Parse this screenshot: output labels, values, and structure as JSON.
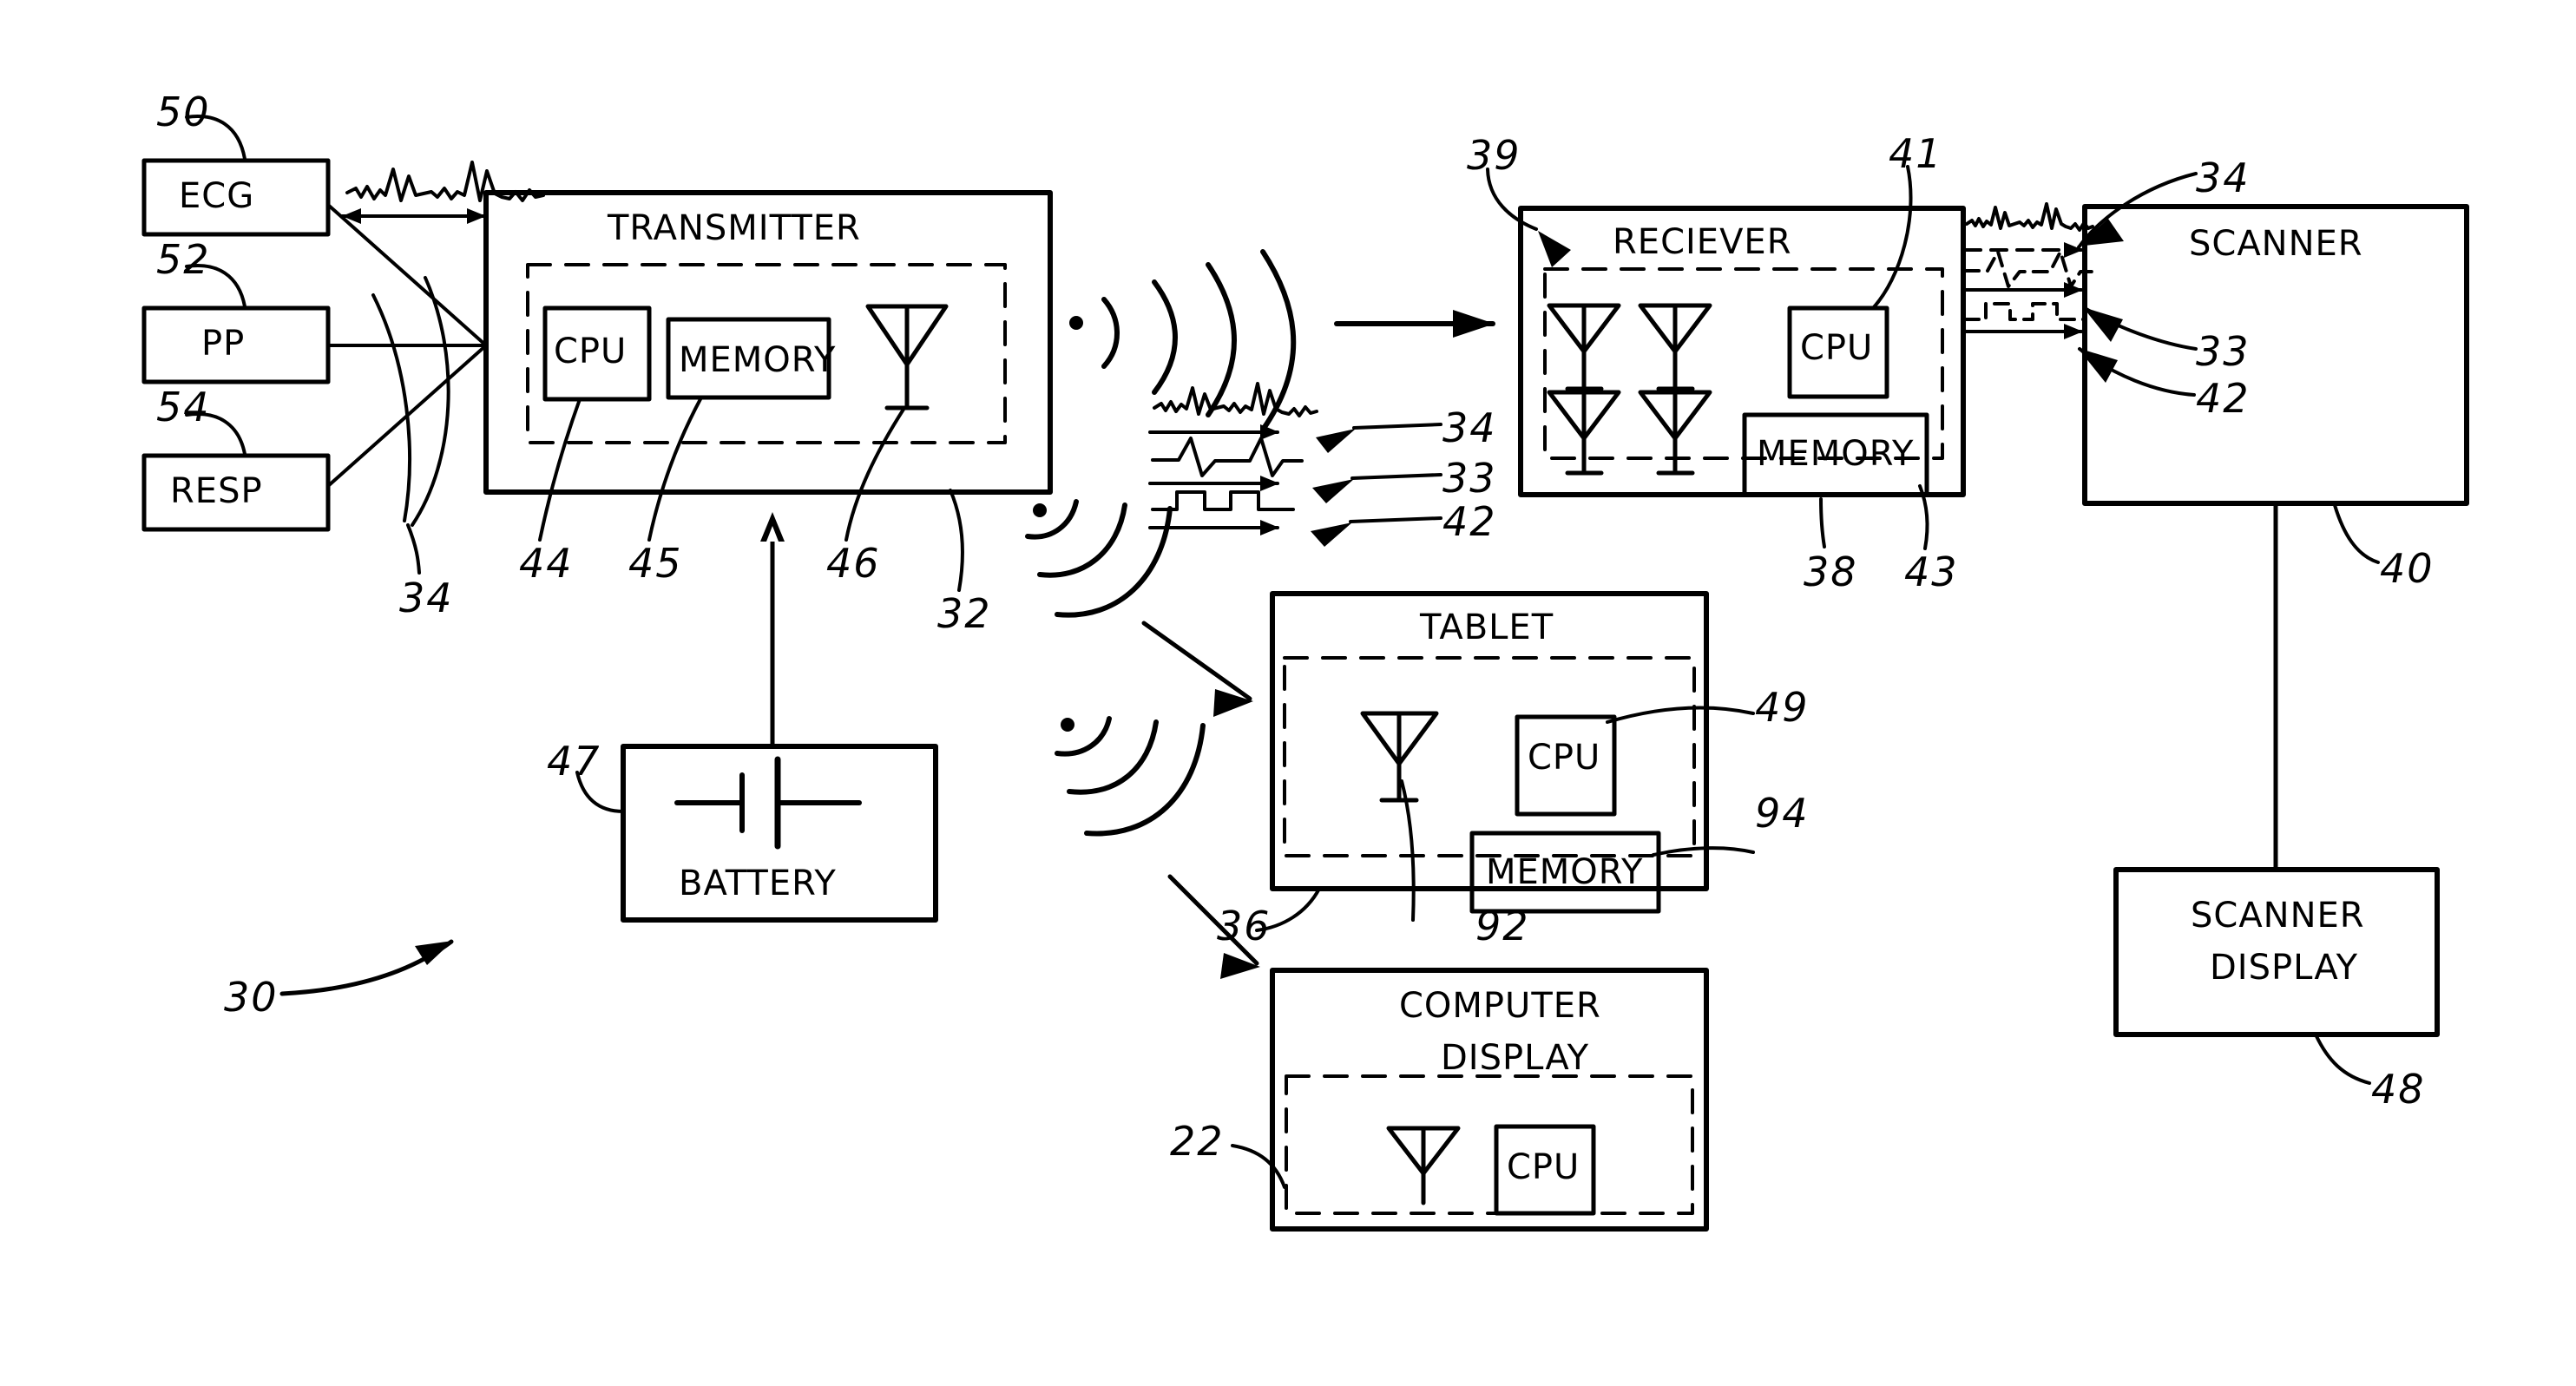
{
  "figure": {
    "kind": "patent-block-diagram",
    "system_ref": "30"
  },
  "blocks": [
    {
      "id": "ecg",
      "label": "ECG",
      "ref": "50"
    },
    {
      "id": "pp",
      "label": "PP",
      "ref": "52"
    },
    {
      "id": "resp",
      "label": "RESP",
      "ref": "54"
    },
    {
      "id": "transmitter",
      "label": "TRANSMITTER",
      "ref": "32",
      "children": [
        {
          "label": "CPU",
          "ref": "44"
        },
        {
          "label": "MEMORY",
          "ref": "45"
        },
        {
          "label": "antenna",
          "ref": "46"
        }
      ]
    },
    {
      "id": "battery",
      "label": "BATTERY",
      "ref": "47"
    },
    {
      "id": "receiver",
      "label": "RECIEVER",
      "ref": "38",
      "children": [
        {
          "label": "CPU",
          "ref": "41"
        },
        {
          "label": "MEMORY",
          "ref": "43"
        },
        {
          "label": "antenna-array",
          "ref": "39"
        }
      ]
    },
    {
      "id": "scanner",
      "label": "SCANNER",
      "ref": "40"
    },
    {
      "id": "scanner_display",
      "label_line1": "SCANNER",
      "label_line2": "DISPLAY",
      "ref": "48"
    },
    {
      "id": "tablet",
      "label": "TABLET",
      "ref": "36",
      "children": [
        {
          "label": "CPU",
          "ref": "49"
        },
        {
          "label": "MEMORY",
          "ref": "94"
        },
        {
          "label": "antenna",
          "ref": "92"
        }
      ]
    },
    {
      "id": "computer_display",
      "label_line1": "COMPUTER",
      "label_line2": "DISPLAY",
      "ref": "22",
      "children": [
        {
          "label": "CPU",
          "ref": ""
        },
        {
          "label": "antenna",
          "ref": ""
        }
      ]
    }
  ],
  "signals": {
    "ecg_waveform_ref": "34",
    "sensor_bundle_ref": "34",
    "mid_waveforms": [
      {
        "ref": "34",
        "type": "ecg"
      },
      {
        "ref": "33",
        "type": "pulse"
      },
      {
        "ref": "42",
        "type": "square"
      }
    ],
    "scanner_inputs": [
      {
        "ref": "34",
        "type": "ecg"
      },
      {
        "ref": "33",
        "type": "pulse"
      },
      {
        "ref": "42",
        "type": "square"
      }
    ]
  },
  "refs": {
    "r22": "22",
    "r30": "30",
    "r32": "32",
    "r33": "33",
    "r34": "34",
    "r34b": "34",
    "r34c": "34",
    "r36": "36",
    "r38": "38",
    "r39": "39",
    "r40": "40",
    "r41": "41",
    "r42": "42",
    "r42b": "42",
    "r43": "43",
    "r44": "44",
    "r45": "45",
    "r46": "46",
    "r47": "47",
    "r48": "48",
    "r49": "49",
    "r50": "50",
    "r52": "52",
    "r54": "54",
    "r92": "92",
    "r94": "94",
    "r33b": "33"
  },
  "texts": {
    "ecg": "ECG",
    "pp": "PP",
    "resp": "RESP",
    "transmitter": "TRANSMITTER",
    "cpu": "CPU",
    "memory": "MEMORY",
    "battery": "BATTERY",
    "receiver": "RECIEVER",
    "scanner": "SCANNER",
    "scanner_display_1": "SCANNER",
    "scanner_display_2": "DISPLAY",
    "tablet": "TABLET",
    "computer_display_1": "COMPUTER",
    "computer_display_2": "DISPLAY"
  },
  "colors": {
    "ink": "#000000",
    "paper": "#ffffff"
  }
}
